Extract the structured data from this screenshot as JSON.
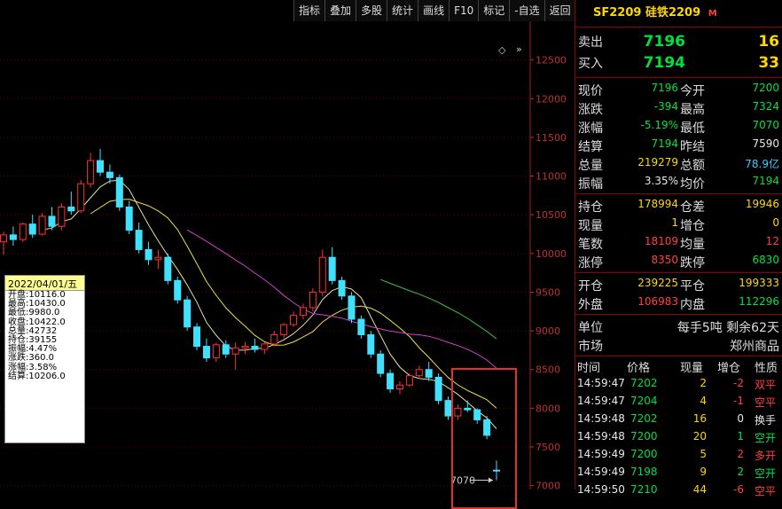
{
  "toolbar": [
    "指标",
    "叠加",
    "多股",
    "统计",
    "画线",
    "F10",
    "标记",
    "-自选",
    "返回"
  ],
  "chart_data": {
    "type": "candlestick",
    "y_ticks": [
      "12500",
      "12000",
      "11500",
      "11000",
      "10500",
      "10000",
      "9500",
      "9000",
      "8500",
      "8000",
      "7500",
      "7000"
    ],
    "ylim": [
      7000,
      12500
    ],
    "last_low_label": "7070",
    "candles": [
      [
        10150,
        10280,
        9980,
        10240
      ],
      [
        10240,
        10350,
        10100,
        10180
      ],
      [
        10180,
        10400,
        10150,
        10380
      ],
      [
        10380,
        10500,
        10200,
        10250
      ],
      [
        10250,
        10520,
        10230,
        10480
      ],
      [
        10480,
        10600,
        10300,
        10350
      ],
      [
        10350,
        10650,
        10300,
        10600
      ],
      [
        10600,
        10800,
        10500,
        10550
      ],
      [
        10550,
        10950,
        10520,
        10900
      ],
      [
        10900,
        11300,
        10850,
        11200
      ],
      [
        11200,
        11350,
        11000,
        11050
      ],
      [
        11050,
        11150,
        10900,
        10980
      ],
      [
        10980,
        11020,
        10550,
        10600
      ],
      [
        10600,
        10680,
        10250,
        10300
      ],
      [
        10300,
        10400,
        10000,
        10050
      ],
      [
        10050,
        10150,
        9850,
        9920
      ],
      [
        9920,
        10050,
        9800,
        9950
      ],
      [
        9950,
        10000,
        9600,
        9650
      ],
      [
        9650,
        9700,
        9350,
        9400
      ],
      [
        9400,
        9450,
        9000,
        9050
      ],
      [
        9050,
        9100,
        8750,
        8800
      ],
      [
        8800,
        8900,
        8600,
        8650
      ],
      [
        8650,
        8850,
        8600,
        8820
      ],
      [
        8820,
        8880,
        8650,
        8700
      ],
      [
        8700,
        8850,
        8500,
        8780
      ],
      [
        8780,
        8860,
        8700,
        8800
      ],
      [
        8800,
        8900,
        8720,
        8760
      ],
      [
        8760,
        8850,
        8700,
        8830
      ],
      [
        8830,
        9000,
        8800,
        8950
      ],
      [
        8950,
        9100,
        8900,
        9080
      ],
      [
        9080,
        9250,
        9050,
        9200
      ],
      [
        9200,
        9350,
        9150,
        9300
      ],
      [
        9300,
        9550,
        9250,
        9500
      ],
      [
        9500,
        10050,
        9450,
        9950
      ],
      [
        9950,
        10080,
        9600,
        9650
      ],
      [
        9650,
        9700,
        9400,
        9450
      ],
      [
        9450,
        9500,
        9100,
        9150
      ],
      [
        9150,
        9200,
        8900,
        8950
      ],
      [
        8950,
        9000,
        8650,
        8700
      ],
      [
        8700,
        8750,
        8400,
        8450
      ],
      [
        8450,
        8500,
        8200,
        8250
      ],
      [
        8250,
        8350,
        8180,
        8300
      ],
      [
        8300,
        8450,
        8280,
        8420
      ],
      [
        8420,
        8550,
        8380,
        8500
      ],
      [
        8500,
        8600,
        8350,
        8400
      ],
      [
        8400,
        8450,
        8050,
        8100
      ],
      [
        8100,
        8150,
        7850,
        7900
      ],
      [
        7900,
        8050,
        7850,
        8000
      ],
      [
        8000,
        8100,
        7950,
        7980
      ],
      [
        7980,
        8000,
        7800,
        7850
      ],
      [
        7850,
        7900,
        7600,
        7650
      ],
      [
        7200,
        7324,
        7070,
        7196
      ]
    ]
  },
  "info_box": {
    "date": "2022/04/01/五",
    "rows": [
      "开盘:10116.0",
      "最高:10430.0",
      "最低:9980.0",
      "收盘:10422.0",
      "总量:42732",
      "持仓:39155",
      "振幅:4.47%",
      "涨跌:360.0",
      "涨幅:3.58%",
      "结算:10206.0"
    ]
  },
  "panel": {
    "symbol": "SF2209",
    "name": "硅铁2209",
    "marker": "M",
    "ask_label": "卖出",
    "ask_price": "7196",
    "ask_vol": "16",
    "bid_label": "买入",
    "bid_price": "7194",
    "bid_vol": "33",
    "quote": [
      {
        "l1": "现价",
        "v1": "7196",
        "c1": "grn",
        "l2": "今开",
        "v2": "7200",
        "c2": "grn"
      },
      {
        "l1": "涨跌",
        "v1": "-394",
        "c1": "grn",
        "l2": "最高",
        "v2": "7324",
        "c2": "grn"
      },
      {
        "l1": "涨幅",
        "v1": "-5.19%",
        "c1": "grn",
        "l2": "最低",
        "v2": "7070",
        "c2": "grn"
      },
      {
        "l1": "结算",
        "v1": "7194",
        "c1": "grn",
        "l2": "昨结",
        "v2": "7590",
        "c2": "wht"
      },
      {
        "l1": "总量",
        "v1": "219279",
        "c1": "yel",
        "l2": "总额",
        "v2": "78.9亿",
        "c2": "cyn"
      },
      {
        "l1": "振幅",
        "v1": "3.35%",
        "c1": "wht",
        "l2": "均价",
        "v2": "7194",
        "c2": "grn"
      }
    ],
    "stats": [
      {
        "l1": "持仓",
        "v1": "178994",
        "c1": "yel",
        "l2": "仓差",
        "v2": "19946",
        "c2": "yel"
      },
      {
        "l1": "现量",
        "v1": "1",
        "c1": "yel",
        "l2": "增仓",
        "v2": "0",
        "c2": "yel"
      },
      {
        "l1": "笔数",
        "v1": "18109",
        "c1": "red",
        "l2": "均量",
        "v2": "12",
        "c2": "red"
      },
      {
        "l1": "涨停",
        "v1": "8350",
        "c1": "red",
        "l2": "跌停",
        "v2": "6830",
        "c2": "grn"
      }
    ],
    "flow": [
      {
        "l1": "开仓",
        "v1": "239225",
        "c1": "yel",
        "l2": "平仓",
        "v2": "199333",
        "c2": "yel"
      },
      {
        "l1": "外盘",
        "v1": "106983",
        "c1": "red",
        "l2": "内盘",
        "v2": "112296",
        "c2": "grn"
      }
    ],
    "unit_label": "单位",
    "unit_val": "每手5吨  剩余62天",
    "market_label": "市场",
    "market_val": "郑州商品",
    "ticks_head": [
      "时间",
      "价格",
      "现量",
      "增仓",
      "性质"
    ],
    "ticks": [
      {
        "t": "14:59:47",
        "p": "7202",
        "v": "2",
        "d": "-2",
        "n": "双平",
        "pc": "grn",
        "dc": "red",
        "nc": "red"
      },
      {
        "t": "14:59:47",
        "p": "7204",
        "v": "4",
        "d": "-1",
        "n": "空平",
        "pc": "grn",
        "dc": "red",
        "nc": "red"
      },
      {
        "t": "14:59:48",
        "p": "7202",
        "v": "16",
        "d": "0",
        "n": "换手",
        "pc": "grn",
        "dc": "wht",
        "nc": "wht"
      },
      {
        "t": "14:59:48",
        "p": "7200",
        "v": "20",
        "d": "1",
        "n": "空开",
        "pc": "grn",
        "dc": "grn",
        "nc": "grn"
      },
      {
        "t": "14:59:49",
        "p": "7200",
        "v": "5",
        "d": "2",
        "n": "多开",
        "pc": "grn",
        "dc": "red",
        "nc": "red"
      },
      {
        "t": "14:59:49",
        "p": "7198",
        "v": "9",
        "d": "2",
        "n": "空开",
        "pc": "grn",
        "dc": "grn",
        "nc": "grn"
      },
      {
        "t": "14:59:50",
        "p": "7210",
        "v": "44",
        "d": "-6",
        "n": "空平",
        "pc": "grn",
        "dc": "red",
        "nc": "red"
      }
    ]
  }
}
